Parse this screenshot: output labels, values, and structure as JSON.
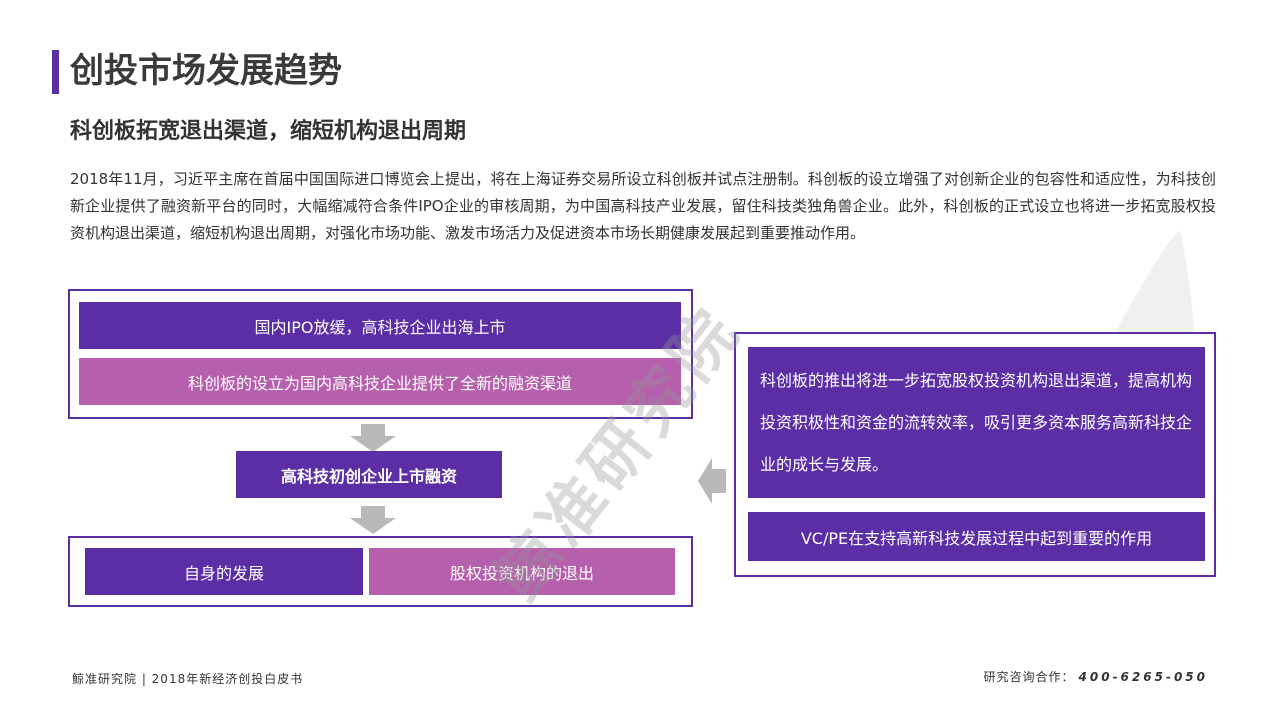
{
  "header": {
    "title": "创投市场发展趋势",
    "subtitle": "科创板拓宽退出渠道，缩短机构退出周期"
  },
  "intro": "2018年11月，习近平主席在首届中国国际进口博览会上提出，将在上海证券交易所设立科创板并试点注册制。科创板的设立增强了对创新企业的包容性和适应性，为科技创新企业提供了融资新平台的同时，大幅缩减符合条件IPO企业的审核周期，为中国高科技产业发展，留住科技类独角兽企业。此外，科创板的正式设立也将进一步拓宽股权投资机构退出渠道，缩短机构退出周期，对强化市场功能、激发市场活力及促进资本市场长期健康发展起到重要推动作用。",
  "diagram": {
    "top_box": {
      "line1": "国内IPO放缓，高科技企业出海上市",
      "line2": "科创板的设立为国内高科技企业提供了全新的融资渠道"
    },
    "middle": "高科技初创企业上市融资",
    "bottom_box": {
      "left": "自身的发展",
      "right": "股权投资机构的退出"
    },
    "right_box": {
      "main": "科创板的推出将进一步拓宽股权投资机构退出渠道，提高机构投资积极性和资金的流转效率，吸引更多资本服务高新科技企业的成长与发展。",
      "bottom": "VC/PE在支持高新科技发展过程中起到重要的作用"
    }
  },
  "watermark": "鲸准研究院",
  "footer": {
    "left": "鲸准研究院 | 2018年新经济创投白皮书",
    "contact_label": "研究咨询合作：",
    "contact_phone": "400-6265-050"
  },
  "colors": {
    "purple": "#5b2ea6",
    "pink": "#b660ad",
    "arrow_gray": "#b8b8b8"
  }
}
